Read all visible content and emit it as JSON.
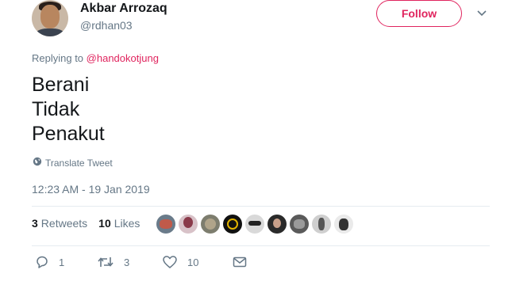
{
  "author": {
    "name": "Akbar Arrozaq",
    "handle": "@rdhan03"
  },
  "follow_label": "Follow",
  "reply": {
    "prefix": "Replying to ",
    "to": "@handokotjung"
  },
  "tweet_lines": [
    "Berani",
    "Tidak",
    "Penakut"
  ],
  "translate_label": "Translate Tweet",
  "timestamp": "12:23 AM - 19 Jan 2019",
  "stats": {
    "retweets_count": "3",
    "retweets_label": "Retweets",
    "likes_count": "10",
    "likes_label": "Likes"
  },
  "liker_avatars": [
    "avatar-1",
    "avatar-2",
    "avatar-3",
    "avatar-4",
    "avatar-5",
    "avatar-6",
    "avatar-7",
    "avatar-8",
    "avatar-9"
  ],
  "actions": {
    "reply_count": "1",
    "retweet_count": "3",
    "like_count": "10"
  },
  "colors": {
    "accent": "#e0245e",
    "secondary_text": "#657786",
    "primary_text": "#14171a",
    "divider": "#e6ecf0"
  }
}
